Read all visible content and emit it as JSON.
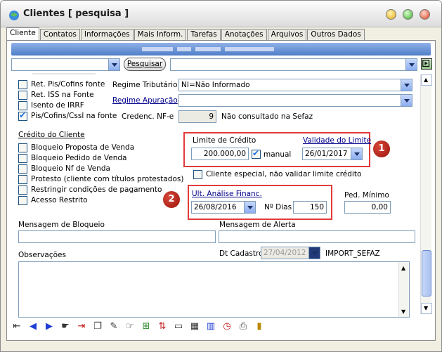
{
  "window": {
    "title": "Clientes [ pesquisa ]"
  },
  "tabs": [
    {
      "label": "Cliente"
    },
    {
      "label": "Contatos"
    },
    {
      "label": "Informações"
    },
    {
      "label": "Mais Inform."
    },
    {
      "label": "Tarefas"
    },
    {
      "label": "Anotações"
    },
    {
      "label": "Arquivos"
    },
    {
      "label": "Outros Dados"
    }
  ],
  "search": {
    "button_label": "Pesquisar",
    "combo_value": "",
    "text_value": ""
  },
  "tax_checkboxes": [
    {
      "label": "Ret. Pis/Cofins fonte",
      "checked": false
    },
    {
      "label": "Ret. ISS na Fonte",
      "checked": false
    },
    {
      "label": "Isento de IRRF",
      "checked": false
    },
    {
      "label": "Pis/Cofins/Cssl na fonte",
      "checked": true
    }
  ],
  "regime": {
    "tributario_label": "Regime Tributário",
    "tributario_value": "NI=Não Informado",
    "apuracao_label": "Regime Apuração",
    "apuracao_value": "",
    "credenc_label": "Credenc. NF-e",
    "credenc_value": "9",
    "credenc_status": "Não consultado na Sefaz"
  },
  "credito": {
    "section_title": "Crédito do Cliente",
    "checkboxes": [
      {
        "label": "Bloqueio Proposta de Venda"
      },
      {
        "label": "Bloqueio Pedido de Venda"
      },
      {
        "label": "Bloqueio Nf de Venda"
      },
      {
        "label": "Protesto (cliente com títulos protestados)"
      },
      {
        "label": "Restringir condições de pagamento"
      },
      {
        "label": "Acesso Restrito"
      }
    ],
    "limite_label": "Limite de Crédito",
    "limite_value": "200.000,00",
    "manual_label": "manual",
    "validade_label": "Validade do Limite",
    "validade_value": "26/01/2017",
    "especial_label": "Cliente especial, não validar limite crédito",
    "ult_analise_label": "Ult. Análise Financ.",
    "ult_analise_value": "26/08/2016",
    "ndias_label": "Nº Dias",
    "ndias_value": "150",
    "ped_minimo_label": "Ped. Mínimo",
    "ped_minimo_value": "0,00"
  },
  "badges": {
    "one": "1",
    "two": "2"
  },
  "mensagens": {
    "bloqueio_label": "Mensagem de Bloqueio",
    "alerta_label": "Mensagem de Alerta",
    "observacoes_label": "Observações",
    "dt_cadastro_label": "Dt Cadastro",
    "dt_cadastro_value": "27/04/2012",
    "import_label": "IMPORT_SEFAZ"
  },
  "toolbar_icons": [
    "first-record-icon",
    "previous-record-icon",
    "next-record-icon",
    "point-icon",
    "insert-icon",
    "copy-icon",
    "edit-icon",
    "select-icon",
    "tree-icon",
    "swap-icon",
    "card-icon",
    "grid-icon",
    "chart-icon",
    "clock-icon",
    "print-icon",
    "exit-icon"
  ],
  "colors": {
    "accent_red": "#e23b3b",
    "header_blue": "#4f7ec8"
  }
}
